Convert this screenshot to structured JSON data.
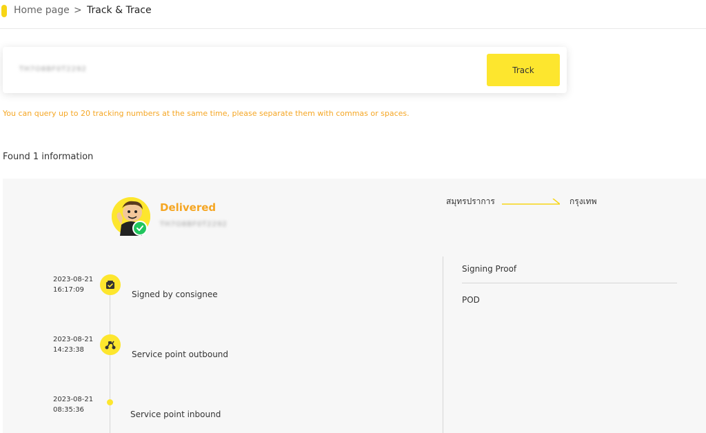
{
  "breadcrumb": {
    "home": "Home page",
    "separator": ">",
    "current": "Track & Trace"
  },
  "search": {
    "value": "TH7O8BF0T2292",
    "button_label": "Track"
  },
  "hint": "You can query up to 20 tracking numbers at the same time, please separate them with commas or spaces.",
  "found_text": "Found 1 information",
  "result": {
    "status": "Delivered",
    "tracking_number": "TH7O8BF0T2292",
    "route": {
      "origin": "สมุทรปราการ",
      "destination": "กรุงเทพ"
    },
    "timeline": [
      {
        "date": "2023-08-21",
        "time": "16:17:09",
        "event": "Signed by consignee",
        "icon": "box-check-icon"
      },
      {
        "date": "2023-08-21",
        "time": "14:23:38",
        "event": "Service point outbound",
        "icon": "scooter-icon"
      },
      {
        "date": "2023-08-21",
        "time": "08:35:36",
        "event": "Service point inbound",
        "icon": "dot"
      }
    ],
    "signing": {
      "title": "Signing Proof",
      "pod": "POD"
    }
  },
  "colors": {
    "brand_yellow": "#fde62e",
    "status_orange": "#f5a623",
    "check_green": "#22c55e"
  }
}
